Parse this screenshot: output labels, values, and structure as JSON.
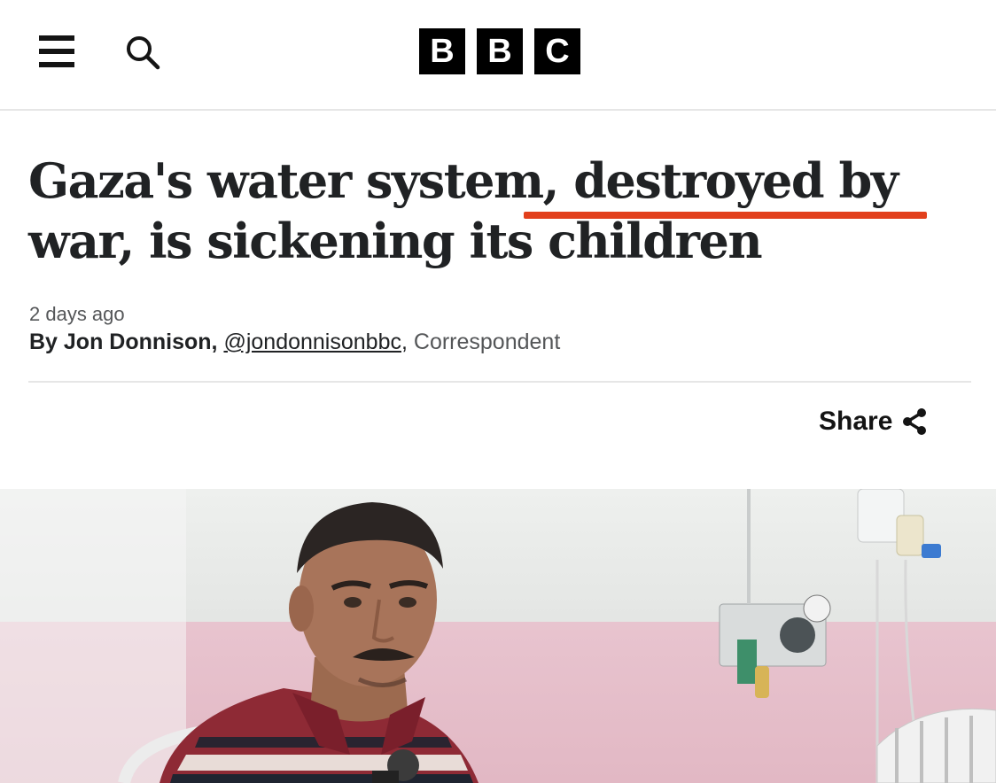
{
  "header": {
    "logo_letters": [
      "B",
      "B",
      "C"
    ],
    "menu_icon": "hamburger-menu-icon",
    "search_icon": "search-icon"
  },
  "article": {
    "headline_part1": "Gaza's water system, ",
    "headline_highlight": "destroyed by war",
    "headline_part2": ", is sickening its children",
    "date": "2 days ago",
    "byline_prefix": "By Jon Donnison,",
    "byline_handle": "@jondonnisonbbc",
    "byline_sep": ",",
    "byline_role": "Correspondent"
  },
  "share": {
    "label": "Share",
    "icon": "share-icon"
  },
  "colors": {
    "highlight_underline": "#e2401c",
    "text": "#202224",
    "muted": "#545658"
  }
}
